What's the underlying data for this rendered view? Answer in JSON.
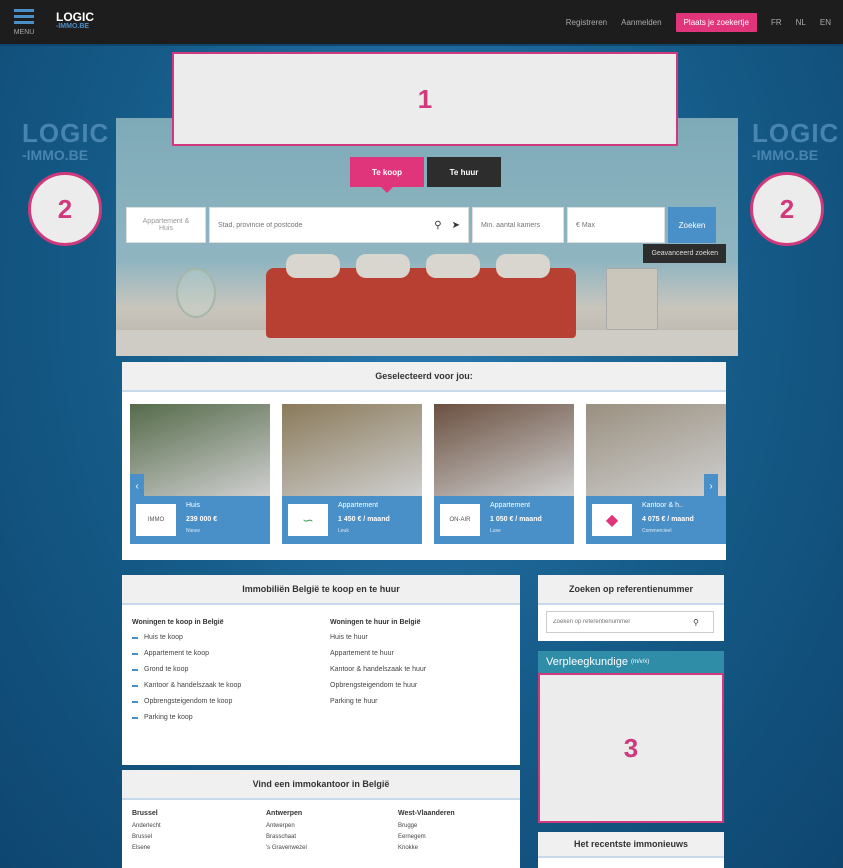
{
  "topbar": {
    "menu_label": "MENU",
    "brand": "LOGIC",
    "brand_sub": "-IMMO.BE",
    "nav": [
      "Registreren",
      "Aanmelden"
    ],
    "cta": "Plaats je zoekertje",
    "lang": [
      "FR",
      "NL",
      "EN"
    ]
  },
  "side_logo": {
    "line1": "LOGIC",
    "line2": "-IMMO.BE"
  },
  "markers": {
    "ad_top": "1",
    "side_left": "2",
    "side_right": "2",
    "ad_side": "3"
  },
  "hero": {
    "tab_buy": "Te koop",
    "tab_rent": "Te huur",
    "type_field": "Appartement & Huis",
    "location_placeholder": "Stad, provincie of postcode",
    "min_placeholder": "Min. aantal kamers",
    "max_placeholder": "€ Max",
    "search_btn": "Zoeken",
    "advanced": "Geavanceerd zoeken"
  },
  "selected": {
    "title": "Geselecteerd voor jou:",
    "cards": [
      {
        "type": "Huis",
        "price": "239 000 €",
        "sub": "Nieuw",
        "agency": "IMMO",
        "color": "#556b4a"
      },
      {
        "type": "Appartement",
        "price": "1 450 € / maand",
        "sub": "Leuk",
        "agency": "",
        "color": "#8a7a5a"
      },
      {
        "type": "Appartement",
        "price": "1 050 € / maand",
        "sub": "Luxe",
        "agency": "ON-AIR",
        "color": "#6b5040"
      },
      {
        "type": "Kantoor & h..",
        "price": "4 075 € / maand",
        "sub": "Commercieel",
        "agency": "",
        "color": "#9a9080"
      }
    ]
  },
  "immo": {
    "title": "Immobiliën België te koop en te huur",
    "buy_head": "Woningen te koop in België",
    "buy_items": [
      "Huis te koop",
      "Appartement te koop",
      "Grond te koop",
      "Kantoor & handelszaak te koop",
      "Opbrengsteigendom te koop",
      "Parking te koop"
    ],
    "rent_head": "Woningen te huur in België",
    "rent_items": [
      "Huis te huur",
      "Appartement te huur",
      "Kantoor & handelszaak te huur",
      "Opbrengsteigendom te huur",
      "Parking te huur"
    ]
  },
  "ref": {
    "title": "Zoeken op referentienummer",
    "placeholder": "Zoeken op referentienummer"
  },
  "job": {
    "title": "Verpleegkundige",
    "sub": "(m/v/x)"
  },
  "news": {
    "title": "Het recentste immonieuws"
  },
  "offices": {
    "title": "Vind een immokantoor in België",
    "cols": [
      {
        "h": "Brussel",
        "rows": [
          "Anderlecht",
          "Brussel",
          "Elsene"
        ]
      },
      {
        "h": "Antwerpen",
        "rows": [
          "Antwerpen",
          "Brasschaat",
          "'s Gravenwezel"
        ]
      },
      {
        "h": "West-Vlaanderen",
        "rows": [
          "Brugge",
          "Eernegem",
          "Knokke"
        ]
      }
    ]
  }
}
